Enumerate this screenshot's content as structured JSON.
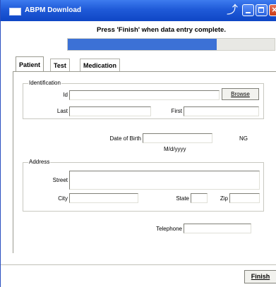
{
  "window": {
    "title": "ABPM Download"
  },
  "header": {
    "instruction": "Press 'Finish' when data entry complete."
  },
  "progress": {
    "fraction": 0.72
  },
  "tabs": [
    {
      "label": "Patient",
      "active": true
    },
    {
      "label": "Test",
      "active": false
    },
    {
      "label": "Medication",
      "active": false
    }
  ],
  "identification": {
    "legend": "Identification",
    "id_label": "Id",
    "id_value": "",
    "browse_label": "Browse",
    "last_label": "Last",
    "last_value": "",
    "first_label": "First",
    "first_value": ""
  },
  "dob": {
    "label": "Date of Birth",
    "value": "",
    "format": "M/d/yyyy",
    "ng": "NG"
  },
  "address": {
    "legend": "Address",
    "street_label": "Street",
    "street_value": "",
    "city_label": "City",
    "city_value": "",
    "state_label": "State",
    "state_value": "",
    "zip_label": "Zip",
    "zip_value": ""
  },
  "telephone": {
    "label": "Telephone",
    "value": ""
  },
  "footer": {
    "finish_label": "Finish"
  },
  "icons": {
    "app": "window-icon",
    "pin": "pin-icon",
    "min": "minimize-icon",
    "max": "maximize-icon",
    "close": "close-icon"
  },
  "colors": {
    "titlebar": "#1f5ad8",
    "progress": "#3c71d6",
    "close": "#c83c1a"
  }
}
